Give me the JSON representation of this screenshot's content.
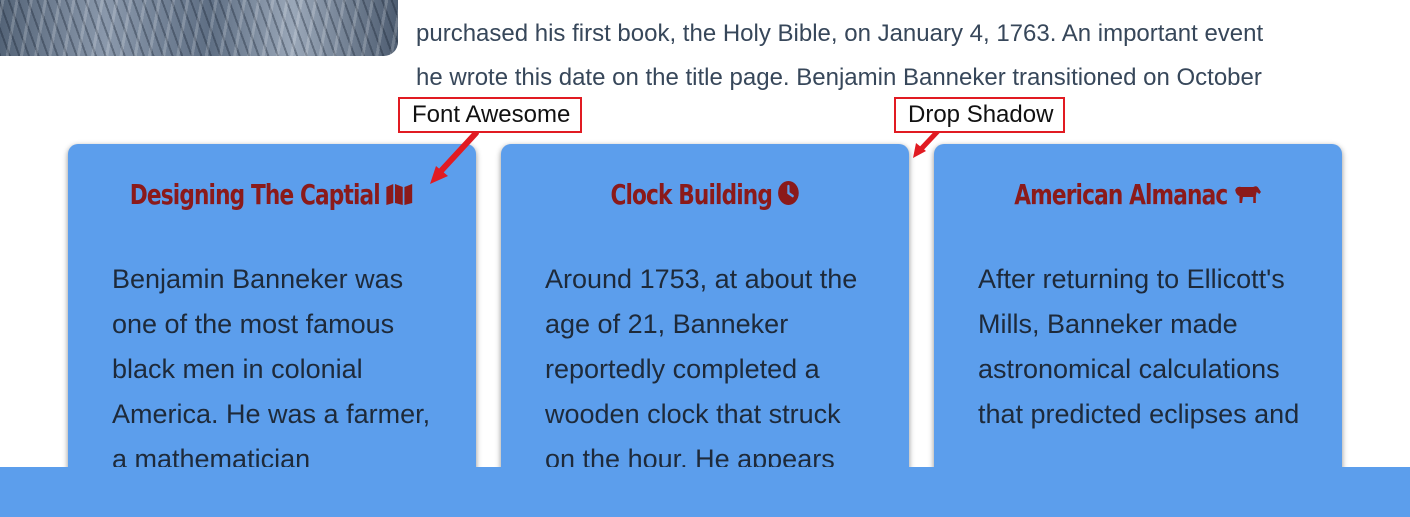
{
  "intro": {
    "line1": "purchased his first book, the Holy Bible, on January 4, 1763. An important event",
    "line2": "he wrote this date on the title page. Benjamin Banneker transitioned on October"
  },
  "callouts": {
    "font_awesome": "Font Awesome",
    "drop_shadow": "Drop Shadow"
  },
  "cards": [
    {
      "title": "Designing The Captial",
      "icon": "map-icon",
      "body": "Benjamin Banneker was one of the most famous black men in colonial America. He was a farmer, a mathematician"
    },
    {
      "title": "Clock Building",
      "icon": "clock-icon",
      "body": "Around 1753, at about the age of 21, Banneker reportedly completed a wooden clock that struck on the hour. He appears"
    },
    {
      "title": "American Almanac",
      "icon": "horse-icon",
      "body": "After returning to Ellicott's Mills, Banneker made astronomical calculations that predicted eclipses and"
    }
  ],
  "colors": {
    "card_bg": "#5c9eec",
    "title": "#8b1a1a",
    "callout_border": "#e11b22"
  }
}
